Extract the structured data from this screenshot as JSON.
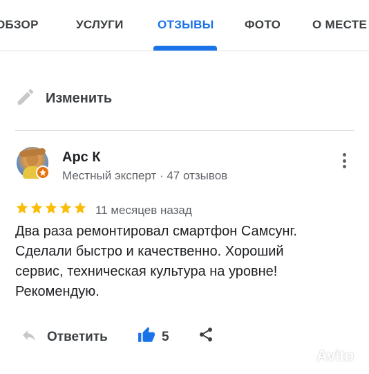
{
  "tabs": [
    {
      "label": "ОБЗОР",
      "active": false
    },
    {
      "label": "УСЛУГИ",
      "active": false
    },
    {
      "label": "ОТЗЫВЫ",
      "active": true
    },
    {
      "label": "ФОТО",
      "active": false
    },
    {
      "label": "О МЕСТЕ",
      "active": false
    }
  ],
  "edit": {
    "label": "Изменить",
    "icon": "pencil-icon"
  },
  "review": {
    "author": "Арс К",
    "author_meta": "Местный эксперт · 47 отзывов",
    "rating": 5,
    "rating_max": 5,
    "date": "11 месяцев назад",
    "text_lines": [
      "Два раза ремонтировал смартфон Самсунг.",
      "Сделали быстро и качественно. Хороший",
      "сервис, техническая культура на уровне!",
      "Рекомендую."
    ]
  },
  "actions": {
    "reply_label": "Ответить",
    "like_count": "5",
    "share_icon": "share-icon"
  },
  "watermark": {
    "text": "Avito"
  },
  "colors": {
    "accent": "#1a73e8",
    "star": "#fbbc04",
    "badge": "#e8710a",
    "text_primary": "#202124",
    "text_secondary": "#5f6368"
  }
}
